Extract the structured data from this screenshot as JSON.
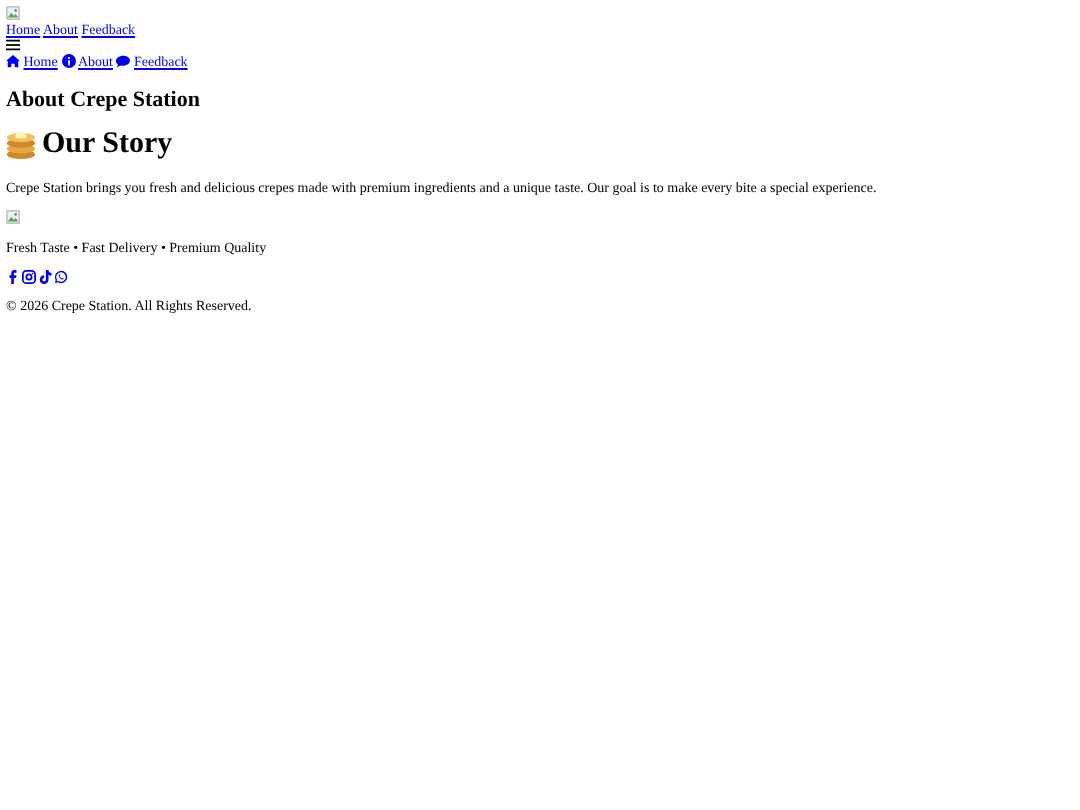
{
  "top_nav": [
    "Home",
    "About",
    "Feedback"
  ],
  "icon_nav": [
    {
      "label": "Home",
      "kind": "home"
    },
    {
      "label": "About",
      "kind": "info"
    },
    {
      "label": "Feedback",
      "kind": "chat"
    }
  ],
  "page_title": "About Crepe Station",
  "heading": "Our Story",
  "paragraph": "Crepe Station brings you fresh and delicious crepes made with premium ingredients and a unique taste. Our goal is to make every bite a special experience.",
  "tagline": "Fresh Taste • Fast Delivery • Premium Quality",
  "social": [
    {
      "kind": "facebook"
    },
    {
      "kind": "instagram"
    },
    {
      "kind": "tiktok"
    },
    {
      "kind": "whatsapp"
    }
  ],
  "copyright": "© 2026 Crepe Station. All Rights Reserved."
}
